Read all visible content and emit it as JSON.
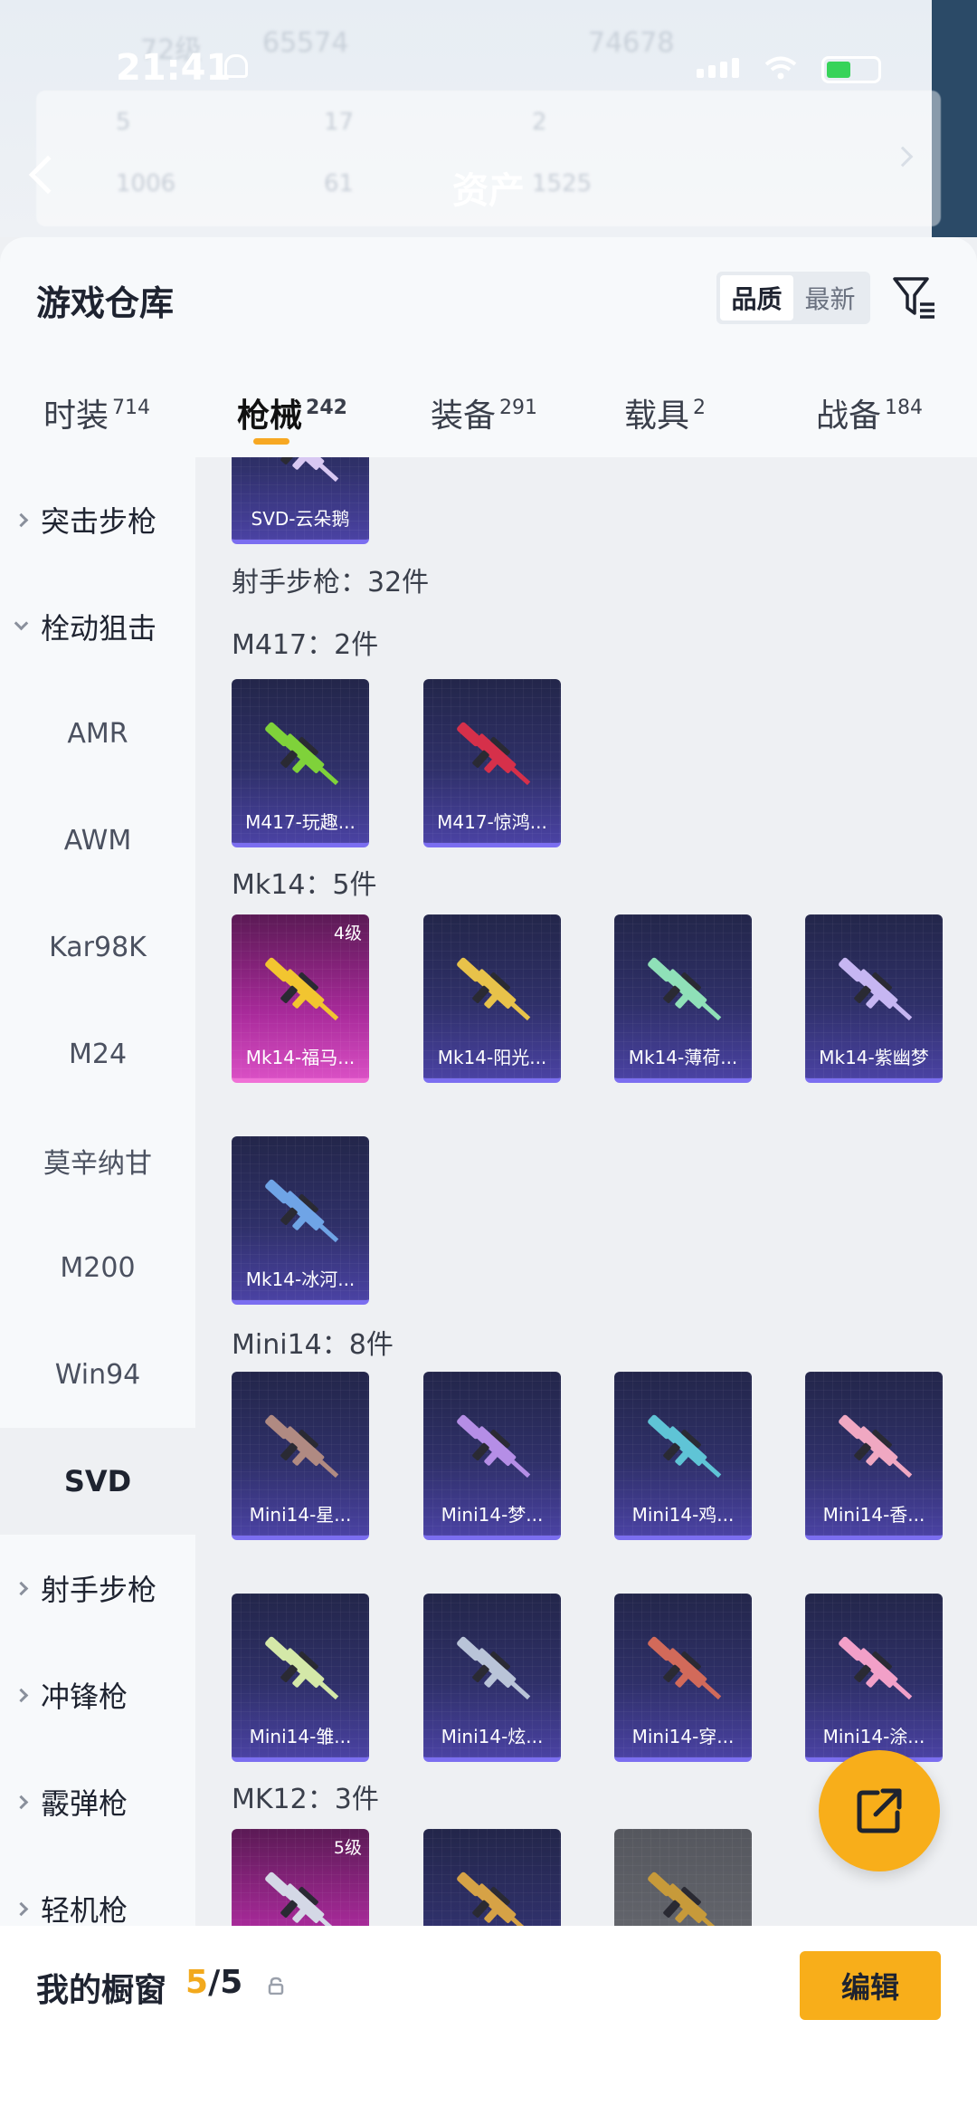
{
  "status_bar": {
    "time": "21:41"
  },
  "profile_header": {
    "level_text": "72级",
    "score_left": "65574",
    "score_right": "74678",
    "stats_row1": [
      "5",
      "17",
      "2"
    ],
    "stats_row2": [
      "1006",
      "61",
      "1525"
    ],
    "title": "资产"
  },
  "panel": {
    "title": "游戏仓库",
    "sort_options": [
      "品质",
      "最新"
    ],
    "active_sort": "品质"
  },
  "tabs": [
    {
      "label": "时装",
      "count": "714"
    },
    {
      "label": "枪械",
      "count": "242"
    },
    {
      "label": "装备",
      "count": "291"
    },
    {
      "label": "载具",
      "count": "2"
    },
    {
      "label": "战备",
      "count": "184"
    }
  ],
  "nav": [
    {
      "label": "突击步枪",
      "kind": "group",
      "expanded": false
    },
    {
      "label": "栓动狙击",
      "kind": "group",
      "expanded": true
    },
    {
      "label": "AMR",
      "kind": "sub"
    },
    {
      "label": "AWM",
      "kind": "sub"
    },
    {
      "label": "Kar98K",
      "kind": "sub"
    },
    {
      "label": "M24",
      "kind": "sub"
    },
    {
      "label": "莫辛纳甘",
      "kind": "sub"
    },
    {
      "label": "M200",
      "kind": "sub"
    },
    {
      "label": "Win94",
      "kind": "sub"
    },
    {
      "label": "SVD",
      "kind": "sub",
      "selected": true
    },
    {
      "label": "射手步枪",
      "kind": "group",
      "expanded": false
    },
    {
      "label": "冲锋枪",
      "kind": "group",
      "expanded": false
    },
    {
      "label": "霰弹枪",
      "kind": "group",
      "expanded": false
    },
    {
      "label": "轻机枪",
      "kind": "group",
      "expanded": false
    }
  ],
  "content": {
    "top_partial_card": {
      "name": "SVD-云朵鹅"
    },
    "category_total": "射手步枪：32件",
    "sections": [
      {
        "label": "M417：2件",
        "items": [
          {
            "name": "M417-玩趣...",
            "color": "#7fd23a"
          },
          {
            "name": "M417-惊鸿...",
            "color": "#d6304a"
          }
        ]
      },
      {
        "label": "Mk14：5件",
        "items": [
          {
            "name": "Mk14-福马...",
            "level": "4级",
            "rarity": "pink",
            "color": "#f2c530"
          },
          {
            "name": "Mk14-阳光...",
            "color": "#e8c24a"
          },
          {
            "name": "Mk14-薄荷...",
            "color": "#8fe0b8"
          },
          {
            "name": "Mk14-紫幽梦",
            "color": "#c6b6f2"
          },
          {
            "name": "Mk14-冰河...",
            "color": "#6fa4e6"
          }
        ]
      },
      {
        "label": "Mini14：8件",
        "items": [
          {
            "name": "Mini14-星...",
            "color": "#b08a82"
          },
          {
            "name": "Mini14-梦...",
            "color": "#b58ee6"
          },
          {
            "name": "Mini14-鸡...",
            "color": "#5fc4d6"
          },
          {
            "name": "Mini14-香...",
            "color": "#f0a8c2"
          },
          {
            "name": "Mini14-雏...",
            "color": "#d4e8a8"
          },
          {
            "name": "Mini14-炫...",
            "color": "#b9c4d8"
          },
          {
            "name": "Mini14-穿...",
            "color": "#d26a5a"
          },
          {
            "name": "Mini14-涂...",
            "color": "#f2a0c8"
          }
        ]
      },
      {
        "label": "MK12：3件",
        "items": [
          {
            "name": "",
            "level": "5级",
            "rarity": "pink",
            "color": "#d4d8e6"
          },
          {
            "name": "",
            "color": "#d6a246"
          },
          {
            "name": "",
            "rarity": "gray",
            "color": "#c79a3a"
          }
        ]
      }
    ]
  },
  "bottom": {
    "showcase_label": "我的橱窗",
    "showcase_current": "5",
    "showcase_total": "/5",
    "edit_label": "编辑"
  },
  "colors": {
    "accent": "#f8ae1a",
    "card_purple": "#4a42a3",
    "card_pink": "#d94fc4"
  }
}
